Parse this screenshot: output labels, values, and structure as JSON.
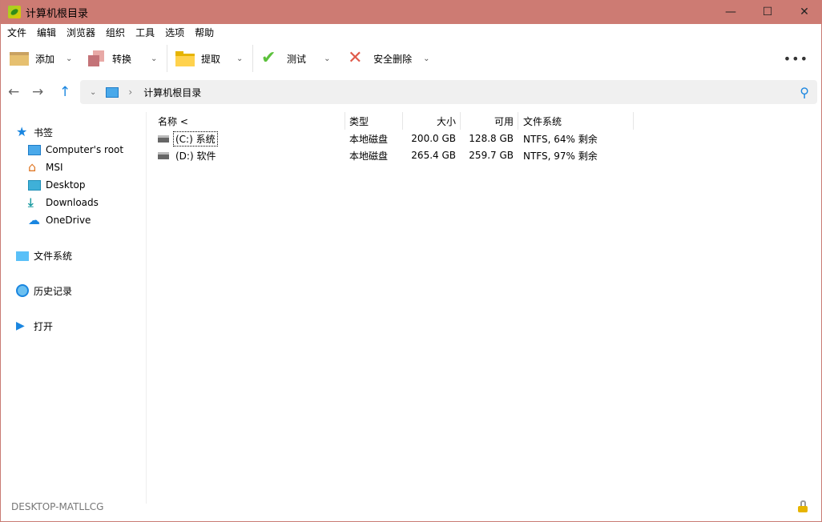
{
  "window": {
    "title": "计算机根目录"
  },
  "menu": [
    "文件",
    "编辑",
    "浏览器",
    "组织",
    "工具",
    "选项",
    "帮助"
  ],
  "toolbar": {
    "add": "添加",
    "convert": "转换",
    "extract": "提取",
    "test": "测试",
    "wipe": "安全删除"
  },
  "address": {
    "crumb": "计算机根目录"
  },
  "sidebar": {
    "bookmarks": "书签",
    "items": [
      "Computer's root",
      "MSI",
      "Desktop",
      "Downloads",
      "OneDrive"
    ],
    "filesystem": "文件系统",
    "history": "历史记录",
    "open": "打开"
  },
  "columns": {
    "name": "名称 <",
    "type": "类型",
    "size": "大小",
    "free": "可用",
    "fs": "文件系统"
  },
  "rows": [
    {
      "name": "(C:) 系统",
      "type": "本地磁盘",
      "size": "200.0 GB",
      "free": "128.8 GB",
      "fs": "NTFS, 64% 剩余"
    },
    {
      "name": "(D:) 软件",
      "type": "本地磁盘",
      "size": "265.4 GB",
      "free": "259.7 GB",
      "fs": "NTFS, 97% 剩余"
    }
  ],
  "status": {
    "computer": "DESKTOP-MATLLCG"
  }
}
